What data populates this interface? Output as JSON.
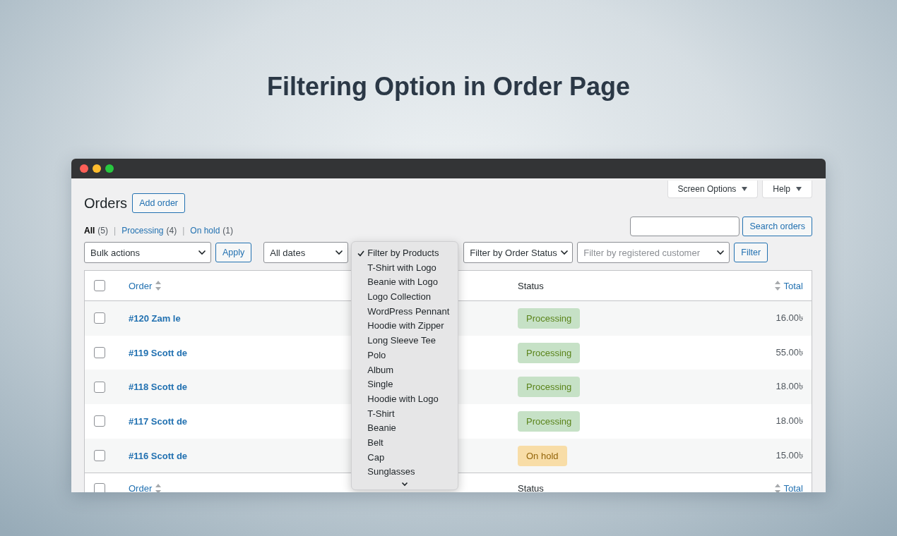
{
  "heading": "Filtering Option in Order Page",
  "screen_meta": [
    {
      "label": "Screen Options"
    },
    {
      "label": "Help"
    }
  ],
  "page_title": "Orders",
  "add_button": "Add order",
  "views": [
    {
      "label": "All",
      "count": "(5)",
      "selected": true
    },
    {
      "separator": "|",
      "label": "Processing",
      "count": "(4)",
      "selected": false
    },
    {
      "separator": "|",
      "label": "On hold",
      "count": "(1)",
      "selected": false
    }
  ],
  "search": {
    "button": "Search orders"
  },
  "filters": {
    "bulk_actions": "Bulk actions",
    "apply": "Apply",
    "dates": "All dates",
    "products_dropdown": {
      "expanded": true,
      "options": [
        {
          "label": "Filter by Products",
          "selected": true
        },
        {
          "label": "T-Shirt with Logo",
          "selected": false
        },
        {
          "label": "Beanie with Logo",
          "selected": false
        },
        {
          "label": "Logo Collection",
          "selected": false
        },
        {
          "label": "WordPress Pennant",
          "selected": false
        },
        {
          "label": "Hoodie with Zipper",
          "selected": false
        },
        {
          "label": "Long Sleeve Tee",
          "selected": false
        },
        {
          "label": "Polo",
          "selected": false
        },
        {
          "label": "Album",
          "selected": false
        },
        {
          "label": "Single",
          "selected": false
        },
        {
          "label": "Hoodie with Logo",
          "selected": false
        },
        {
          "label": "T-Shirt",
          "selected": false
        },
        {
          "label": "Beanie",
          "selected": false
        },
        {
          "label": "Belt",
          "selected": false
        },
        {
          "label": "Cap",
          "selected": false
        },
        {
          "label": "Sunglasses",
          "selected": false
        }
      ]
    },
    "order_status": "Filter by Order Status",
    "customer_placeholder": "Filter by registered customer",
    "filter_button": "Filter"
  },
  "table": {
    "header_checkbox": {
      "checked": false
    },
    "footer_checkbox": {
      "checked": false
    },
    "columns": [
      {
        "label": "Order",
        "sortable": true
      },
      {
        "label": "Status",
        "sortable": false
      },
      {
        "label": "Total",
        "sortable": true
      }
    ],
    "rows": [
      {
        "checked": false,
        "order": "#120 Zam le",
        "status": "Processing",
        "kind": "processing",
        "total": "16.00৳"
      },
      {
        "checked": false,
        "order": "#119 Scott de",
        "status": "Processing",
        "kind": "processing",
        "total": "55.00৳"
      },
      {
        "checked": false,
        "order": "#118 Scott de",
        "status": "Processing",
        "kind": "processing",
        "total": "18.00৳"
      },
      {
        "checked": false,
        "order": "#117 Scott de",
        "status": "Processing",
        "kind": "processing",
        "total": "18.00৳"
      },
      {
        "checked": false,
        "order": "#116 Scott de",
        "status": "On hold",
        "kind": "on-hold",
        "total": "15.00৳"
      }
    ],
    "footer_columns": [
      {
        "label": "Order",
        "sortable": true
      },
      {
        "label": "Status",
        "sortable": false
      },
      {
        "label": "Total",
        "sortable": true
      }
    ]
  }
}
